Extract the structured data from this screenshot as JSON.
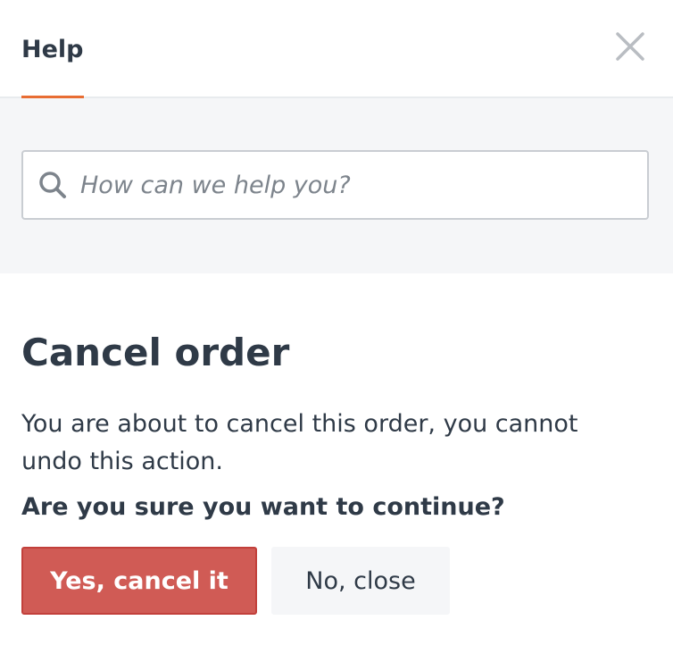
{
  "header": {
    "tab_label": "Help"
  },
  "search": {
    "placeholder": "How can we help you?",
    "value": ""
  },
  "dialog": {
    "title": "Cancel order",
    "message": "You are about to cancel this order, you cannot undo this action.",
    "question": "Are you sure you want to continue?",
    "confirm_label": "Yes, cancel it",
    "cancel_label": "No, close"
  },
  "icons": {
    "close": "close-icon",
    "search": "search-icon"
  },
  "colors": {
    "accent": "#e86d33",
    "danger": "#d05b55",
    "danger_border": "#c2403b",
    "text": "#2f3a47",
    "panel_bg": "#f5f6f8"
  }
}
